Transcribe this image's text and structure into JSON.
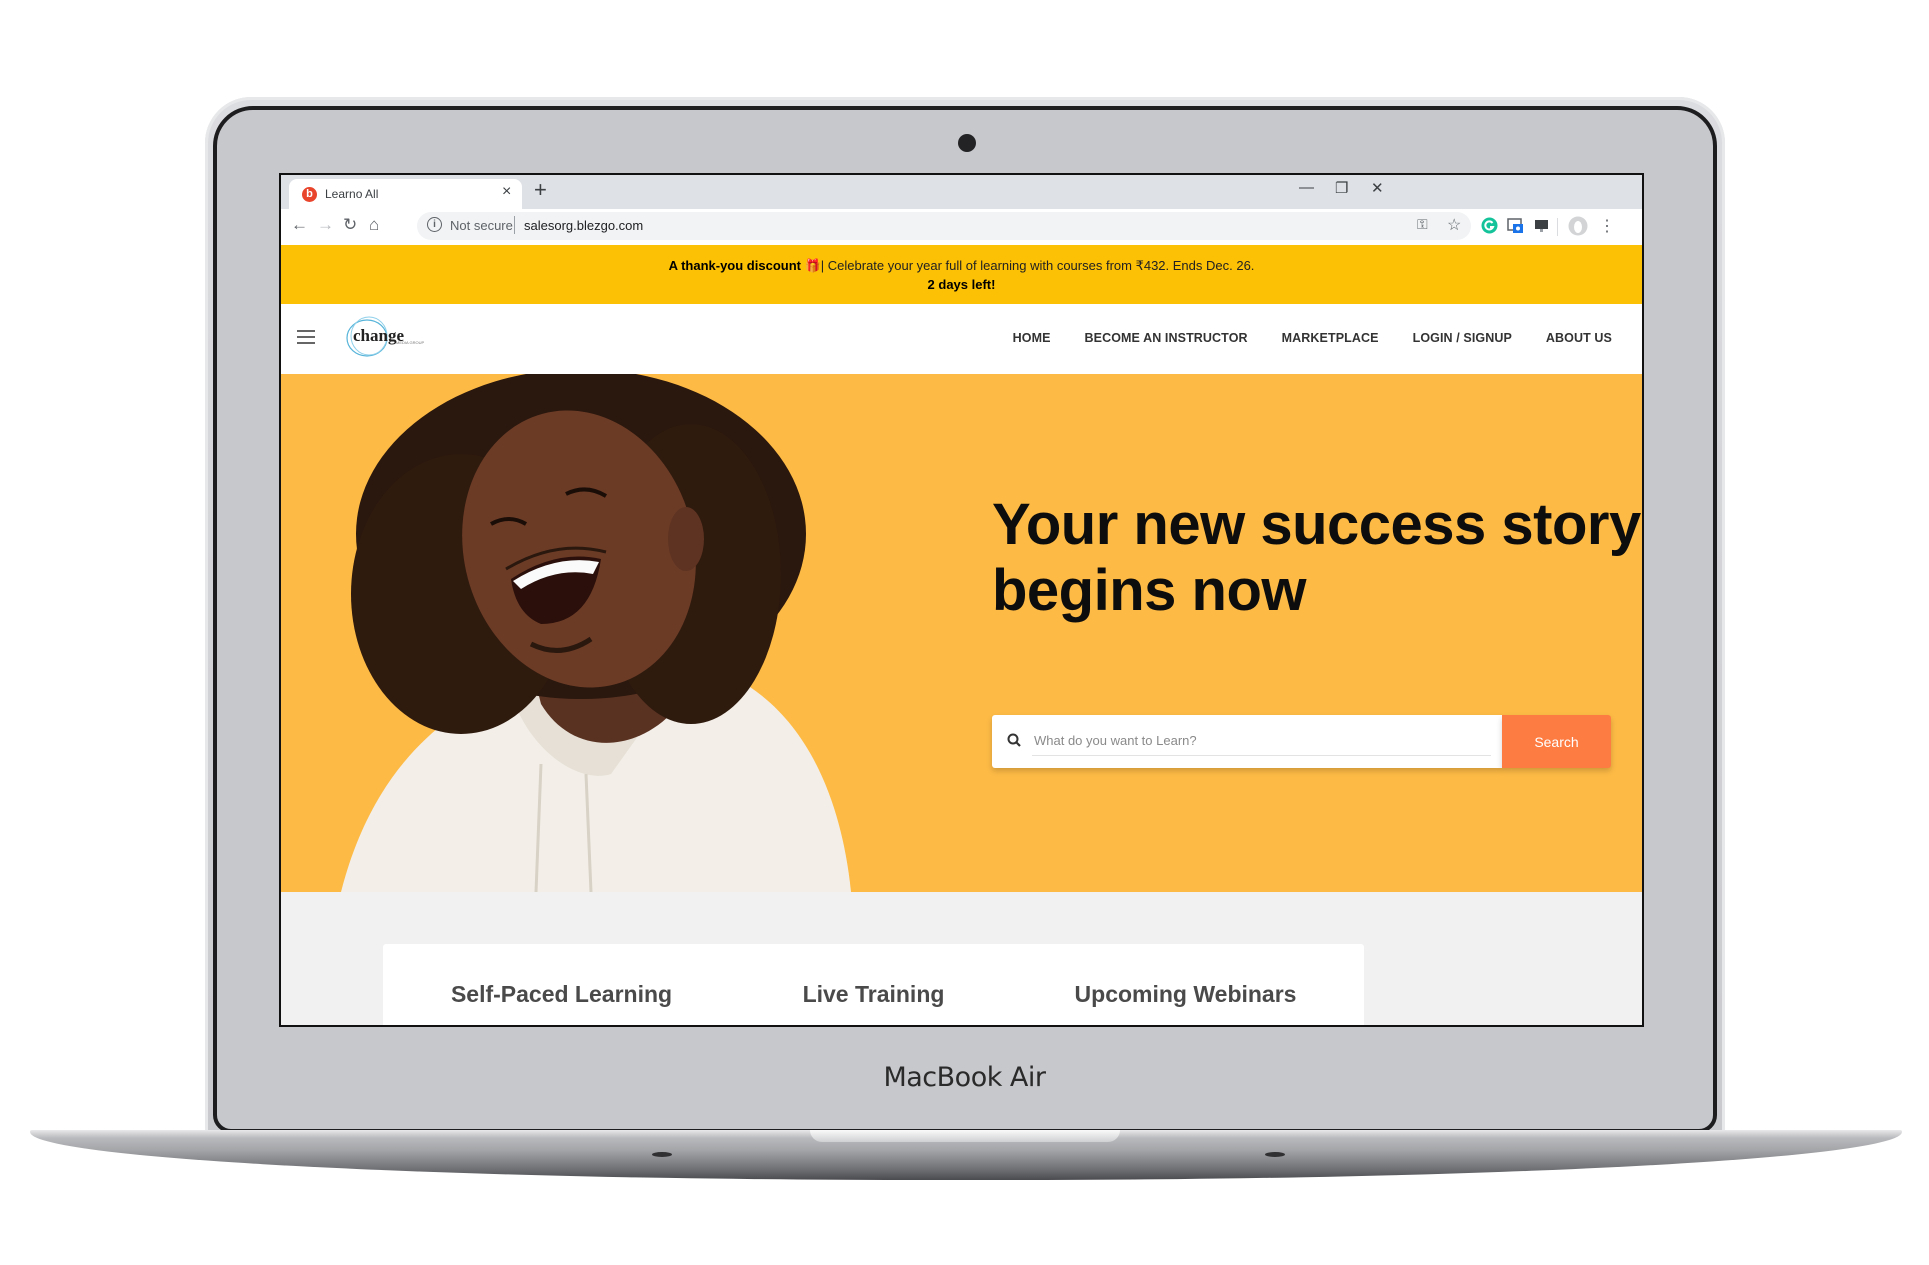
{
  "device": {
    "brand_label": "MacBook Air"
  },
  "browser": {
    "tab": {
      "title": "Learno All",
      "favicon_letter": "b",
      "favicon_color": "#e8452c"
    },
    "new_tab_label": "+",
    "window_controls": {
      "minimize": "—",
      "restore": "❐",
      "close": "✕"
    },
    "toolbar": {
      "back": "←",
      "forward": "→",
      "reload": "↻",
      "home": "⌂"
    },
    "omnibox": {
      "security_label": "Not secure",
      "url": "salesorg.blezgo.com"
    },
    "extensions": [
      "key-icon",
      "star-icon",
      "grammarly-icon",
      "screenshot-extension-icon",
      "cast-icon",
      "profile-avatar",
      "menu-icon"
    ]
  },
  "banner": {
    "bold_text": "A thank-you discount",
    "gift_icon": "🎁",
    "text": "| Celebrate your year full of learning with courses from ₹432. Ends Dec. 26.",
    "countdown": "2 days left!",
    "background": "#fcc004"
  },
  "site_nav": {
    "logo_text": "change",
    "logo_subtext": "MEDIA GROUP",
    "items": [
      {
        "label": "HOME"
      },
      {
        "label": "BECOME AN INSTRUCTOR"
      },
      {
        "label": "MARKETPLACE"
      },
      {
        "label": "LOGIN / SIGNUP"
      },
      {
        "label": "ABOUT US"
      }
    ]
  },
  "hero": {
    "headline": "Your new success story begins now",
    "background": "#fdba45",
    "search": {
      "placeholder": "What do you want to Learn?",
      "value": "",
      "button_label": "Search",
      "button_color": "#fd7c42"
    }
  },
  "cards": [
    {
      "label": "Self-Paced Learning"
    },
    {
      "label": "Live Training"
    },
    {
      "label": "Upcoming Webinars"
    }
  ]
}
